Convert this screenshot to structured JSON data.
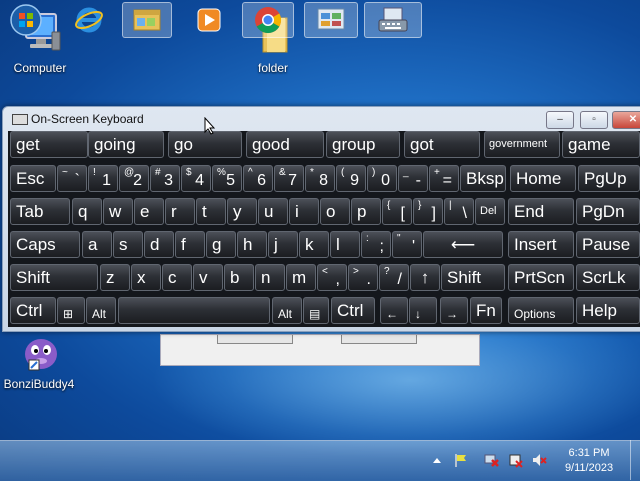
{
  "desktop": {
    "icons": [
      {
        "label": "Computer",
        "icon": "computer-icon"
      },
      {
        "label": "folder",
        "icon": "folder-icon"
      },
      {
        "label": "BonziBuddy4",
        "icon": "bonzibuddy-icon"
      }
    ]
  },
  "osk": {
    "title": "On-Screen Keyboard",
    "controls": {
      "minimize": "‒",
      "restore": "▫",
      "close": "✕"
    },
    "predictions": [
      "get",
      "going",
      "go",
      "good",
      "group",
      "got",
      "government",
      "game"
    ],
    "row1": [
      {
        "main": "Esc"
      },
      {
        "lower": "`",
        "upper": "~"
      },
      {
        "lower": "1",
        "upper": "!"
      },
      {
        "lower": "2",
        "upper": "@"
      },
      {
        "lower": "3",
        "upper": "#"
      },
      {
        "lower": "4",
        "upper": "$"
      },
      {
        "lower": "5",
        "upper": "%"
      },
      {
        "lower": "6",
        "upper": "^"
      },
      {
        "lower": "7",
        "upper": "&"
      },
      {
        "lower": "8",
        "upper": "*"
      },
      {
        "lower": "9",
        "upper": "("
      },
      {
        "lower": "0",
        "upper": ")"
      },
      {
        "lower": "-",
        "upper": "_"
      },
      {
        "lower": "=",
        "upper": "+"
      },
      {
        "main": "Bksp"
      },
      {
        "main": "Home"
      },
      {
        "main": "PgUp"
      }
    ],
    "row2": [
      {
        "main": "Tab"
      },
      {
        "main": "q"
      },
      {
        "main": "w"
      },
      {
        "main": "e"
      },
      {
        "main": "r"
      },
      {
        "main": "t"
      },
      {
        "main": "y"
      },
      {
        "main": "u"
      },
      {
        "main": "i"
      },
      {
        "main": "o"
      },
      {
        "main": "p"
      },
      {
        "lower": "[",
        "upper": "{"
      },
      {
        "lower": "]",
        "upper": "}"
      },
      {
        "lower": "\\",
        "upper": "|"
      },
      {
        "main": "Del"
      },
      {
        "main": "End"
      },
      {
        "main": "PgDn"
      }
    ],
    "row3": [
      {
        "main": "Caps"
      },
      {
        "main": "a"
      },
      {
        "main": "s"
      },
      {
        "main": "d"
      },
      {
        "main": "f"
      },
      {
        "main": "g"
      },
      {
        "main": "h"
      },
      {
        "main": "j"
      },
      {
        "main": "k"
      },
      {
        "main": "l"
      },
      {
        "lower": ";",
        "upper": ":"
      },
      {
        "lower": "'",
        "upper": "\""
      },
      {
        "main": "⟵"
      },
      {
        "main": "Insert"
      },
      {
        "main": "Pause"
      }
    ],
    "row4": [
      {
        "main": "Shift"
      },
      {
        "main": "z"
      },
      {
        "main": "x"
      },
      {
        "main": "c"
      },
      {
        "main": "v"
      },
      {
        "main": "b"
      },
      {
        "main": "n"
      },
      {
        "main": "m"
      },
      {
        "lower": ",",
        "upper": "<"
      },
      {
        "lower": ".",
        "upper": ">"
      },
      {
        "lower": "/",
        "upper": "?"
      },
      {
        "main": "↑"
      },
      {
        "main": "Shift"
      },
      {
        "main": "PrtScn"
      },
      {
        "main": "ScrLk"
      }
    ],
    "row5": [
      {
        "main": "Ctrl"
      },
      {
        "main": "⊞"
      },
      {
        "main": "Alt"
      },
      {
        "main": ""
      },
      {
        "main": "Alt"
      },
      {
        "main": "▤"
      },
      {
        "main": "Ctrl"
      },
      {
        "main": "←"
      },
      {
        "main": "↓"
      },
      {
        "main": "→"
      },
      {
        "main": "Fn"
      },
      {
        "main": "Options"
      },
      {
        "main": "Help"
      }
    ]
  },
  "taskbar": {
    "buttons": [
      {
        "icon": "start-orb-icon"
      },
      {
        "icon": "internet-explorer-icon"
      },
      {
        "icon": "file-explorer-icon"
      },
      {
        "icon": "media-player-icon"
      },
      {
        "icon": "chrome-icon"
      },
      {
        "icon": "control-panel-icon"
      },
      {
        "icon": "on-screen-keyboard-icon"
      }
    ],
    "clock": {
      "time": "6:31 PM",
      "date": "9/11/2023"
    }
  }
}
